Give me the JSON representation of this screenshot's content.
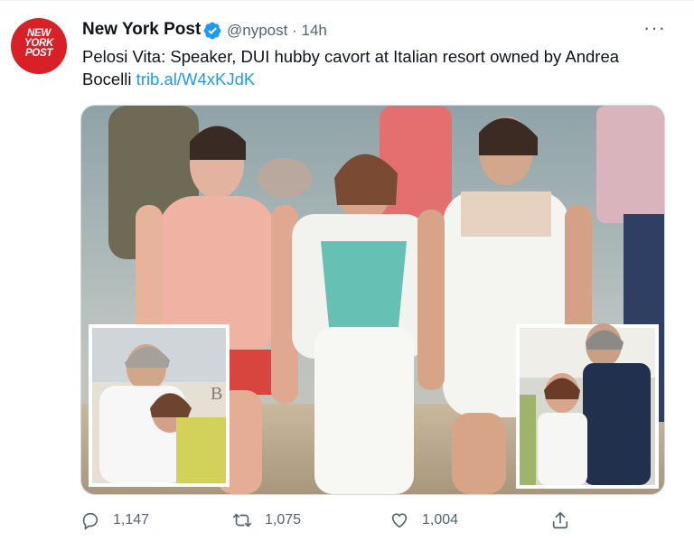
{
  "account": {
    "display_name": "New York Post",
    "handle": "@nypost",
    "separator": "·",
    "time": "14h",
    "avatar_logo": [
      "NEW",
      "YORK",
      "POST"
    ]
  },
  "tweet": {
    "text": "Pelosi Vita: Speaker, DUI hubby cavort at Italian resort owned by Andrea Bocelli",
    "link": "trib.al/W4xKJdK"
  },
  "media": {
    "description_icon": "photo",
    "inset_letter": "B"
  },
  "actions": {
    "replies": "1,147",
    "retweets": "1,075",
    "likes": "1,004"
  },
  "colors": {
    "brand_red": "#d82027",
    "link_blue": "#1d9bf0",
    "muted_gray": "#536471"
  }
}
